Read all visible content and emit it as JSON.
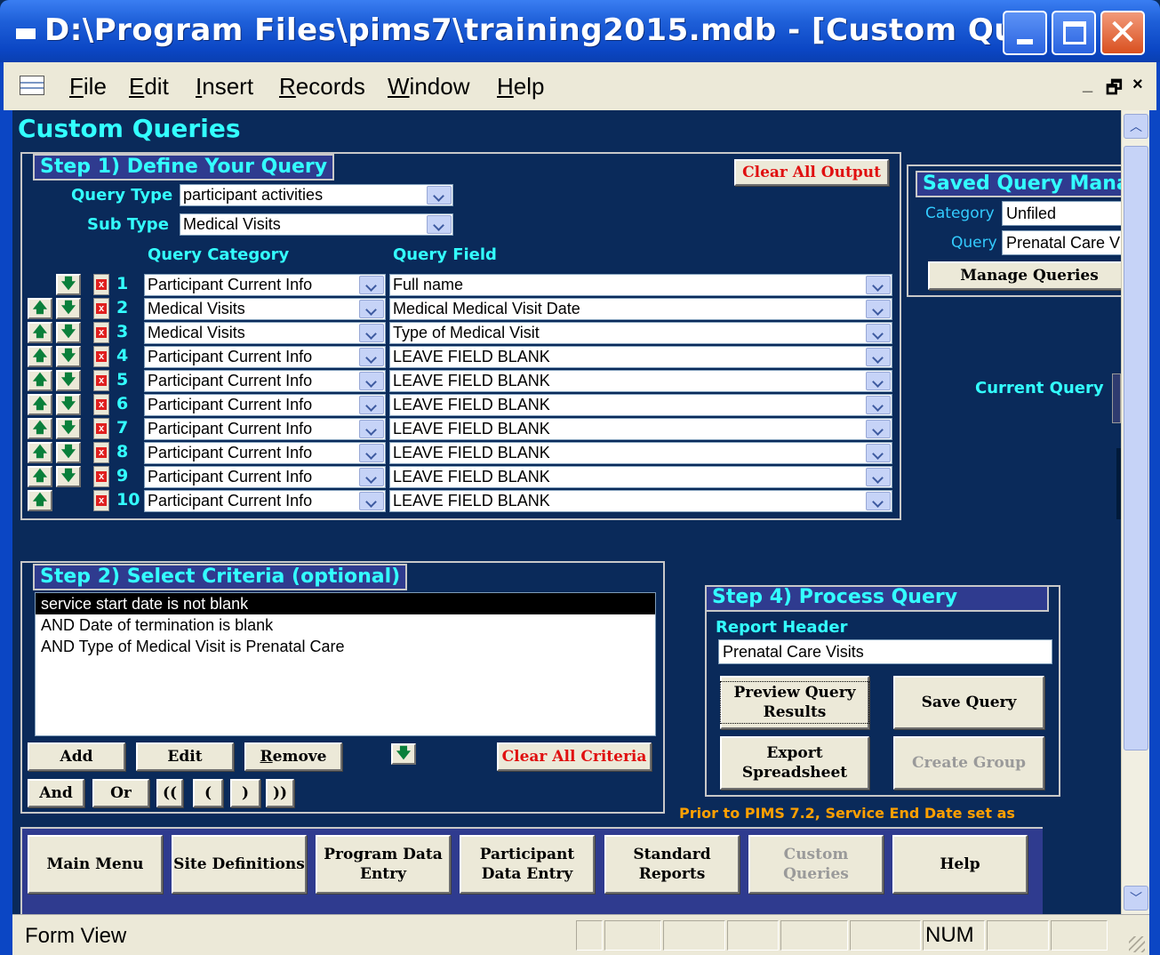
{
  "window": {
    "title": "D:\\Program Files\\pims7\\training2015.mdb - [Custom Que..."
  },
  "menu": {
    "items": [
      {
        "pre": "",
        "u": "F",
        "post": "ile"
      },
      {
        "pre": "",
        "u": "E",
        "post": "dit"
      },
      {
        "pre": "",
        "u": "I",
        "post": "nsert"
      },
      {
        "pre": "",
        "u": "R",
        "post": "ecords"
      },
      {
        "pre": "",
        "u": "W",
        "post": "indow"
      },
      {
        "pre": "",
        "u": "H",
        "post": "elp"
      }
    ],
    "restore": "₪",
    "close": "×"
  },
  "page": {
    "title": "Custom Queries"
  },
  "step1": {
    "header": "Step 1) Define Your Query",
    "clear_output": "Clear All Output",
    "query_type_label": "Query Type",
    "query_type": "participant activities",
    "sub_type_label": "Sub Type",
    "sub_type": "Medical Visits",
    "col_category": "Query Category",
    "col_field": "Query Field",
    "rows": [
      {
        "num": "1",
        "category": "Participant Current Info",
        "field": "Full name"
      },
      {
        "num": "2",
        "category": "Medical Visits",
        "field": "Medical Medical Visit Date"
      },
      {
        "num": "3",
        "category": "Medical Visits",
        "field": "Type of Medical Visit"
      },
      {
        "num": "4",
        "category": "Participant Current Info",
        "field": "LEAVE FIELD BLANK"
      },
      {
        "num": "5",
        "category": "Participant Current Info",
        "field": "LEAVE FIELD BLANK"
      },
      {
        "num": "6",
        "category": "Participant Current Info",
        "field": "LEAVE FIELD BLANK"
      },
      {
        "num": "7",
        "category": "Participant Current Info",
        "field": "LEAVE FIELD BLANK"
      },
      {
        "num": "8",
        "category": "Participant Current Info",
        "field": "LEAVE FIELD BLANK"
      },
      {
        "num": "9",
        "category": "Participant Current Info",
        "field": "LEAVE FIELD BLANK"
      },
      {
        "num": "10",
        "category": "Participant Current Info",
        "field": "LEAVE FIELD BLANK"
      }
    ]
  },
  "saved": {
    "header": "Saved Query Mana",
    "category_label": "Category",
    "category": "Unfiled",
    "query_label": "Query",
    "query": "Prenatal Care V",
    "manage": "Manage Queries",
    "current_query_label": "Current Query"
  },
  "step2": {
    "header": "Step 2) Select Criteria (optional)",
    "criteria": [
      "service start date is not blank",
      "AND Date of termination is blank",
      "AND Type of Medical Visit is Prenatal Care"
    ],
    "add": "Add",
    "edit": "Edit",
    "remove_u": "R",
    "remove_rest": "emove",
    "clear_criteria": "Clear All Criteria",
    "and": "And",
    "or": "Or",
    "dbl_open": "((",
    "open": "(",
    "close": ")",
    "dbl_close": "))"
  },
  "step4": {
    "header": "Step 4) Process Query",
    "report_header_label": "Report Header",
    "report_header": "Prenatal Care Visits",
    "preview": "Preview Query Results",
    "save": "Save Query",
    "export": "Export Spreadsheet",
    "create_group": "Create Group"
  },
  "note": "Prior to PIMS 7.2, Service End Date set as",
  "nav": {
    "main_menu": "Main Menu",
    "site_definitions": "Site Definitions",
    "program_data_entry": "Program Data Entry",
    "participant_data_entry": "Participant Data Entry",
    "standard_reports": "Standard Reports",
    "custom_queries": "Custom Queries",
    "help": "Help"
  },
  "status": {
    "view": "Form View",
    "num": "NUM"
  }
}
